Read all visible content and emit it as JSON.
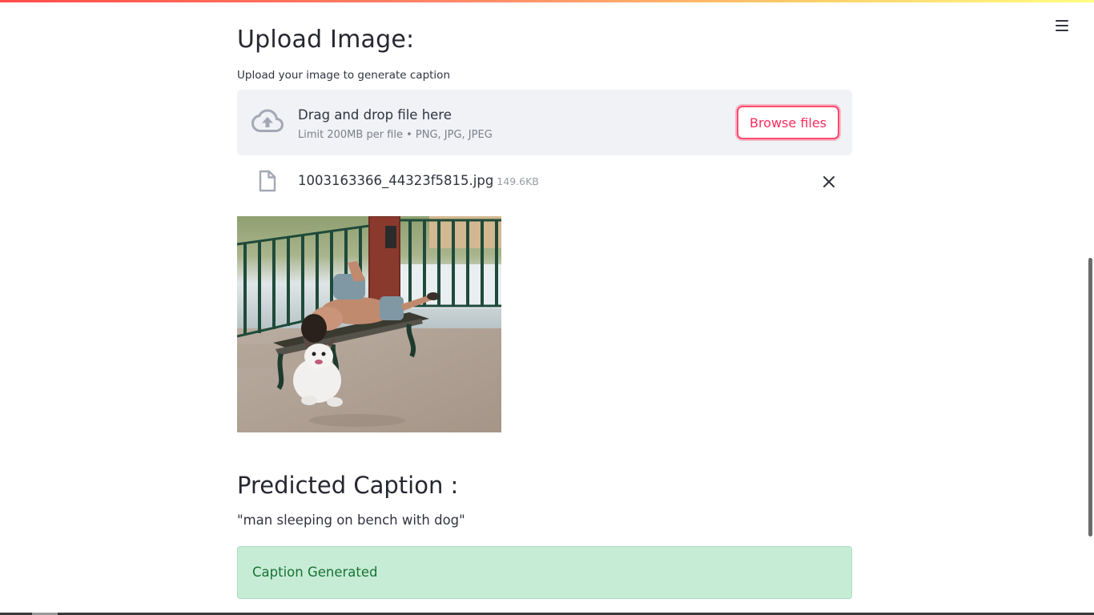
{
  "upload": {
    "heading": "Upload Image:",
    "label": "Upload your image to generate caption",
    "dropzone_title": "Drag and drop file here",
    "dropzone_limit": "Limit 200MB per file • PNG, JPG, JPEG",
    "browse_label": "Browse files"
  },
  "file": {
    "name": "1003163366_44323f5815.jpg",
    "size": "149.6KB"
  },
  "prediction": {
    "heading": "Predicted Caption :",
    "caption": "\"man sleeping on bench with dog\"",
    "status": "Caption Generated"
  },
  "icons": {
    "menu": "hamburger-menu-icon",
    "upload": "cloud-upload-icon",
    "file": "file-icon",
    "remove": "close-icon"
  },
  "colors": {
    "accent": "#ff4b6e",
    "dropzone_bg": "#f0f2f6",
    "success_bg": "#c7ecd6",
    "success_text": "#177233"
  }
}
